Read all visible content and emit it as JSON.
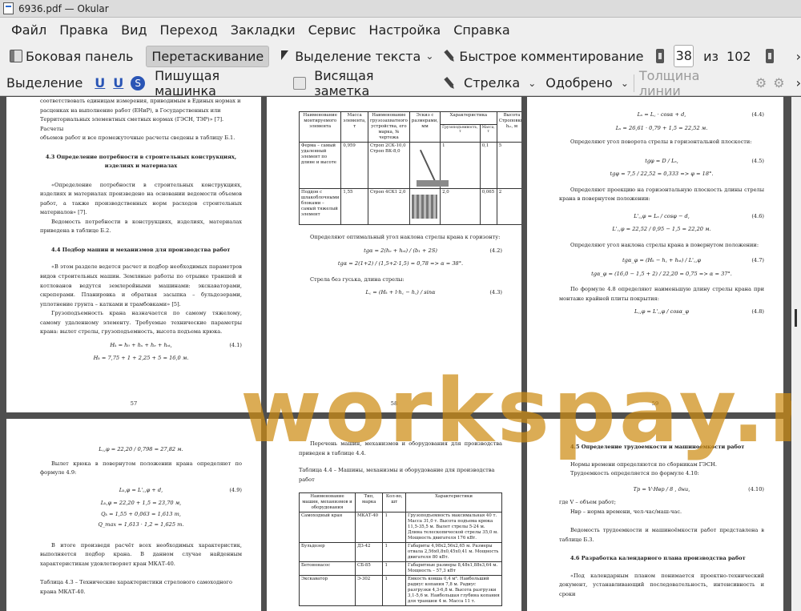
{
  "window": {
    "title": "6936.pdf  — Okular"
  },
  "menu": [
    "Файл",
    "Правка",
    "Вид",
    "Переход",
    "Закладки",
    "Сервис",
    "Настройка",
    "Справка"
  ],
  "toolbar1": {
    "side_panel": "Боковая панель",
    "drag": "Перетаскивание",
    "text_select": "Выделение текста",
    "quick_comment": "Быстрое комментирование",
    "page_current": "38",
    "page_of": "из",
    "page_total": "102"
  },
  "toolbar2": {
    "highlight": "Выделение",
    "typewriter": "Пишущая машинка",
    "sticky_note": "Висящая заметка",
    "arrow": "Стрелка",
    "stamp": "Одобрено",
    "line_width": "Толщина линии"
  },
  "watermark": "workspay.ru",
  "pages": {
    "p57": {
      "lines": [
        "соответствовать единицам измерения, приводимым в Единых нормах и",
        "расценках на выполнение работ (ЕНиР), в Государственных или",
        "Территориальных элементных сметных нормах (ГЭСН, ТЭР)» [7]. Расчеты",
        "объемов работ и все промежуточные расчеты сведены в таблицу Б.1."
      ],
      "h43": "4.3 Определение потребности в строительных конструкциях, изделиях и материалах",
      "p43a": "«Определение потребности в строительных конструкциях, изделиях и материалах произведено на основании ведомости объемов работ, а также производственных норм расходов строительных материалов» [7].",
      "p43b": "Ведомость потребности в конструкциях, изделиях, материалах приведена в таблице Б.2.",
      "h44": "4.4 Подбор машин и механизмов для производства работ",
      "p44a": "«В этом разделе ведется расчет и подбор необходимых параметров видов строительных машин. Земляные работы по отрывке траншей и котлованов ведутся землеройными машинами: экскаваторами, скреперами. Планировка и обратная засыпка – бульдозерами, уплотнение грунта – катками и трамбовками» [5].",
      "p44b": "Грузоподъемность крана назначается по самому тяжелому, самому удаленному элементу. Требуемые технические параметры крана: вылет стрелы, грузоподъемность, высота подъема крюка.",
      "f1": "Hₖ = h₀ + hₛ + hₑ + hₛₜ,",
      "f1n": "(4.1)",
      "f2": "Hₖ = 7,75 + 1 + 2,25 + 5 = 16,0 м.",
      "num": "57"
    },
    "p58": {
      "headers": [
        "Наименование монтируемого элемента",
        "Масса элемента, т",
        "Наименование грузозахватного устройства, его марка, № чертежа",
        "Эскиз с размерами, мм",
        "Характеристика",
        "Грузоподъемность, т",
        "Масса, т",
        "Высота Строповки, hₛₜ, м"
      ],
      "rows": [
        [
          "Ферма – самый удаленный элемент по длине и высоте",
          "0,959",
          "Строп 2СК-10,0 Строп ВК-8,0",
          "",
          "1",
          "0,1",
          "5"
        ],
        [
          "Поддон с шлакоблочными блоками – самый тяжелый элемент",
          "1,55",
          "Строп 4СК1 2,0",
          "",
          "2,0",
          "0,065",
          "2"
        ]
      ],
      "p1": "Определяют оптимальный угол наклона стрелы крана к горизонту:",
      "f1": "tgα = 2(hₑ + hₛₜ) / (b₁ + 2S)",
      "f1n": "(4.2)",
      "f2": "tgα = 2(1+2) / (1,5+2·1,5) = 0,78 => α = 38°.",
      "p2": "Стрела без гуська, длина стрелы:",
      "f3": "L꜀ = (Hₖ + l·h꜀ − h꜀) / sinα",
      "f3n": "(4.3)",
      "num": "58"
    },
    "p59": {
      "f1": "Lₛ = L꜀ · cosα + d,",
      "f1n": "(4.4)",
      "f2": "Lₛ = 26,61 · 0,79 + 1,5 = 22,52 м.",
      "p1": "Определяют угол поворота стрелы в горизонтальной плоскости:",
      "f3": "tgφ = D / Lₛ,",
      "f3n": "(4.5)",
      "f4": "tgφ = 7,5 / 22,52 = 0,333 => φ = 18°.",
      "p2": "Определяют проекцию на горизонтальную плоскость длины стрелы крана в повернутом положении:",
      "f5": "L'꜀,φ = Lₛ / cosφ − d,",
      "f5n": "(4.6)",
      "f6": "L'꜀,φ = 22,52 / 0,95 − 1,5 = 22,20 м.",
      "p3": "Определяют угол наклона стрелы крана в повернутом положении:",
      "f7": "tgα_φ = (Hₖ − h꜀ + hₛₜ) / L'꜀,φ",
      "f7n": "(4.7)",
      "f8": "tgα_φ = (16,0 − 1,5 + 2) / 22,20 = 0,75 => α = 37°.",
      "p4": "По формуле 4.8 определяют наименьшую длину стрелы крана при монтаже крайней плиты покрытия:",
      "f9": "L꜀,φ = L'꜀,φ / cosα_φ",
      "f9n": "(4.8)",
      "num": "59"
    },
    "p60": {
      "f1": "L꜀,φ = 22,20 / 0,798 = 27,82 м.",
      "p1": "Вылет крюка в повернутом положении крана определяют по формуле 4.9:",
      "f2": "Lₖ,φ = L'꜀,φ + d,",
      "f2n": "(4.9)",
      "f3": "Lₖ,φ = 22,20 + 1,5 = 23,70 м,",
      "f4": "Qₖ = 1,55 + 0,063 = 1,613 т,",
      "f5": "Q_max = 1,613 · 1,2 = 1,625 т.",
      "p2": "В итоге произведя расчёт всех необходимых характеристик, выполняется подбор крана. В данном случае найденным характеристикам удовлетворяет кран МКАТ-40.",
      "cap": "Таблица 4.3 – Технические характеристики стрелового самоходного крана МКАТ-40."
    },
    "p61": {
      "p1": "Перечень машин, механизмов и оборудования для производства приведен в таблице 4.4.",
      "cap": "Таблица 4.4 – Машины, механизмы и оборудование для производства работ",
      "headers": [
        "Наименование машин, механизмов и оборудования",
        "Тип, марка",
        "Кол-во, шт",
        "Характеристики"
      ],
      "rows": [
        [
          "Самоходный кран",
          "МКАТ-40",
          "1",
          "Грузоподъемность максимальная 40 т. Масса 31,0 т. Высота подъема крюка 11,5-35,5 м. Вылет стрелы 5-24 м. Длина телескопической стрелы 35,0 м. Мощность двигателя 176 кВт."
        ],
        [
          "Бульдозер",
          "ДЗ-42",
          "1",
          "Габариты 4,98х2,56х2,65 м. Размеры отвала 2,56х0,8х0,45х0,41 м. Мощность двигателя 80 кВт."
        ],
        [
          "Бетононасос",
          "СБ-85",
          "1",
          "Габаритные размеры 8,48х1,88х3,64 м. Мощность – 57,3 кВт"
        ],
        [
          "Экскаватор",
          "Э-302",
          "1",
          "Емкость ковша 0,4 м³. Наибольший радиус копания 7,8 м. Радиус разгрузки 4,3-6,8 м. Высота разгрузки 3,1-5,6 м. Наибольшая глубина копания для траншеи 4 м. Масса 11 т."
        ]
      ]
    },
    "p62": {
      "h45": "4.5 Определение трудоемкости и машиноемкости работ",
      "p1": "Нормы времени определяются по сборникам ГЭСН.",
      "p2": "Трудоемкость определяется по формуле 4.10:",
      "f1": "Тр = V·Hвр / 8 , дни,",
      "f1n": "(4.10)",
      "p3": "где V – объем работ;",
      "p4": "Hвр – норма времени, чел-час/маш-час.",
      "p5": "Ведомость трудоемкости и машиноёмкости работ представлена в таблице Б.3.",
      "h46": "4.6 Разработка календарного плана производства работ",
      "p6": "«Под календарным планом понимается проектно-технический документ, устанавливающий последовательность, интенсивность и сроки"
    }
  }
}
